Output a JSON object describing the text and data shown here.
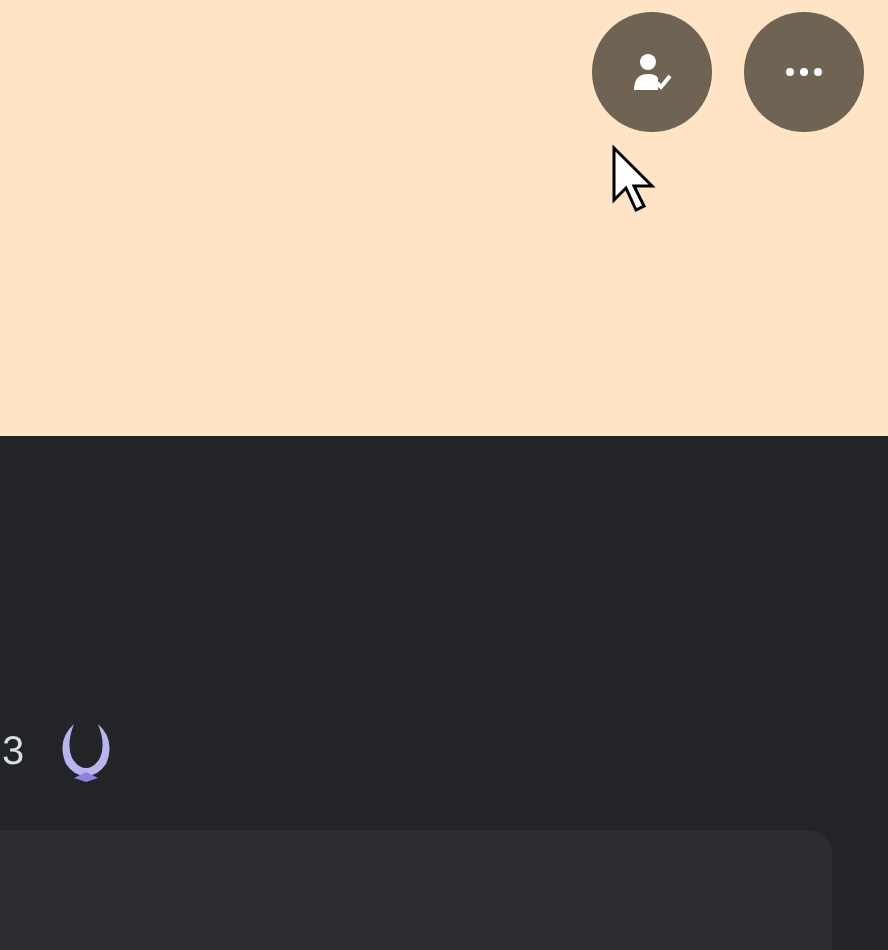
{
  "banner": {
    "color": "#ffe4c6"
  },
  "profile": {
    "count_fragment": "3"
  }
}
